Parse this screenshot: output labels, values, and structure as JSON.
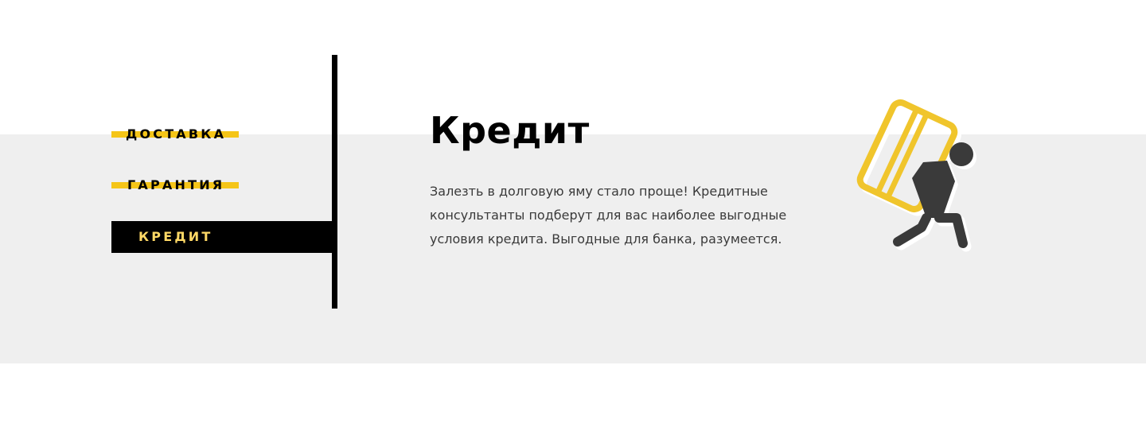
{
  "tabs": [
    {
      "label": "ДОСТАВКА",
      "active": false
    },
    {
      "label": "ГАРАНТИЯ",
      "active": false
    },
    {
      "label": "КРЕДИТ",
      "active": true
    }
  ],
  "content": {
    "title": "Кредит",
    "description": "Залезть в долговую яму стало проще! Кредитные консультанты подберут для вас наиболее выгодные условия кредита. Выгодные для банка, разумеется."
  },
  "illustration": {
    "icon": "person-carrying-credit-card-icon"
  },
  "colors": {
    "accent": "#f5c518",
    "active_label": "#ffd966",
    "band": "#efefef",
    "text": "#3a3a3a",
    "icon_dark": "#3a3a3a"
  }
}
